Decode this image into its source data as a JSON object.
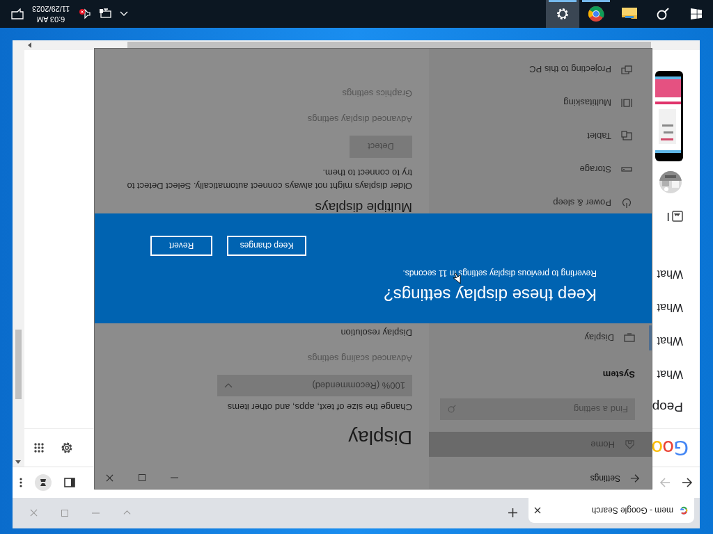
{
  "taskbar": {
    "apps": [
      {
        "kind": "start",
        "running": false,
        "selected": false
      },
      {
        "kind": "search",
        "running": false,
        "selected": false
      },
      {
        "kind": "files",
        "running": false,
        "selected": false
      },
      {
        "kind": "browser",
        "running": true,
        "selected": false
      },
      {
        "kind": "settings",
        "running": true,
        "selected": true
      }
    ],
    "tray": {
      "time": "6:03 AM",
      "date": "11/29/2023",
      "volume_muted": true
    }
  },
  "browser": {
    "tab": {
      "title": "mem - Google Search"
    },
    "back_enabled": true,
    "forward_enabled": false,
    "page": {
      "logo": "Goo",
      "heading": "Peop",
      "results": [
        "What",
        "What",
        "What",
        "What"
      ],
      "images_label": "I"
    }
  },
  "settings": {
    "title": "Settings",
    "sidebar": {
      "home": "Home",
      "search_placeholder": "Find a setting",
      "section": "System",
      "items": [
        {
          "kind": "display",
          "label": "Display",
          "selected": true
        },
        {
          "kind": "power",
          "label": "Power & sleep",
          "selected": false
        },
        {
          "kind": "storage",
          "label": "Storage",
          "selected": false
        },
        {
          "kind": "tablet",
          "label": "Tablet",
          "selected": false
        },
        {
          "kind": "multitasking",
          "label": "Multitasking",
          "selected": false
        },
        {
          "kind": "projecting",
          "label": "Projecting to this PC",
          "selected": false
        }
      ]
    },
    "main": {
      "heading": "Display",
      "scale_label": "Change the size of text, apps, and other items",
      "scale_value": "100% (Recommended)",
      "scaling_link": "Advanced scaling settings",
      "resolution_label": "Display resolution",
      "multiple_heading": "Multiple displays",
      "multiple_text": "Older displays might not always connect automatically. Select Detect to try to connect to them.",
      "detect_button": "Detect",
      "links": [
        "Advanced display settings",
        "Graphics settings"
      ]
    },
    "dialog": {
      "title": "Keep these display settings?",
      "message": "Reverting to previous display settings in 11 seconds.",
      "buttons": [
        "Keep changes",
        "Revert"
      ]
    }
  }
}
